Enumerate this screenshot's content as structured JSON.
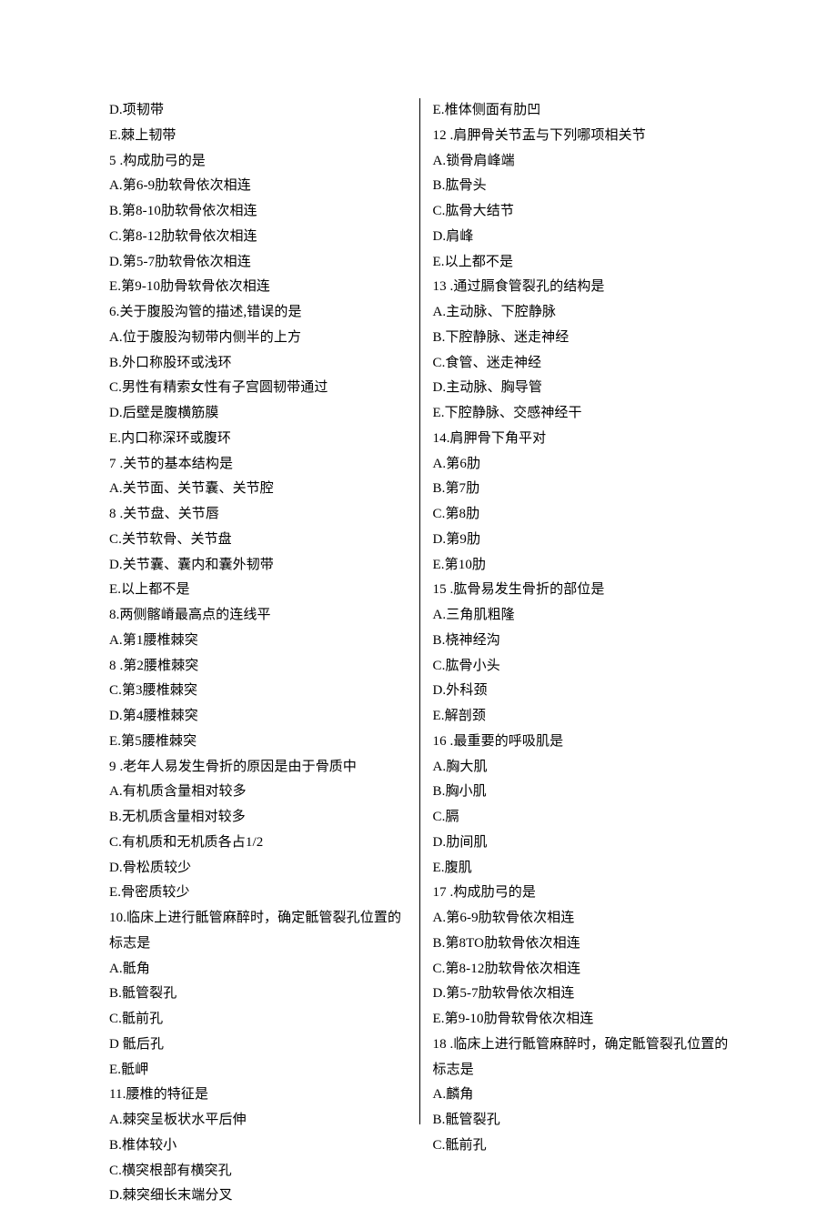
{
  "left": [
    "D.项韧带",
    "E.棘上韧带",
    "5 .构成肋弓的是",
    "A.第6-9肋软骨依次相连",
    "B.第8-10肋软骨依次相连",
    "C.第8-12肋软骨依次相连",
    "D.第5-7肋软骨依次相连",
    "E.第9-10肋骨软骨依次相连",
    "6.关于腹股沟管的描述,错误的是",
    "A.位于腹股沟韧带内侧半的上方",
    "B.外口称股环或浅环",
    "C.男性有精索女性有子宫圆韧带通过",
    "D.后壁是腹横筋膜",
    "E.内口称深环或腹环",
    "7 .关节的基本结构是",
    "A.关节面、关节囊、关节腔",
    "8 .关节盘、关节唇",
    "C.关节软骨、关节盘",
    "D.关节囊、囊内和囊外韧带",
    "E.以上都不是",
    "8.两侧髂嵴最高点的连线平",
    "A.第1腰椎棘突",
    "8 .第2腰椎棘突",
    "C.第3腰椎棘突",
    "D.第4腰椎棘突",
    "E.第5腰椎棘突",
    "9 .老年人易发生骨折的原因是由于骨质中",
    "A.有机质含量相对较多",
    "B.无机质含量相对较多",
    "C.有机质和无机质各占1/2",
    "D.骨松质较少",
    "E.骨密质较少",
    "10.临床上进行骶管麻醉时，确定骶管裂孔位置的标志是",
    "A.骶角",
    "B.骶管裂孔",
    "C.骶前孔",
    "D 骶后孔",
    "E.骶岬",
    "11.腰椎的特征是",
    "A.棘突呈板状水平后伸",
    "B.椎体较小",
    "C.横突根部有横突孔",
    "D.棘突细长末端分叉"
  ],
  "right": [
    "E.椎体侧面有肋凹",
    "12 .肩胛骨关节盂与下列哪项相关节",
    "A.锁骨肩峰端",
    "B.肱骨头",
    "C.肱骨大结节",
    "D.肩峰",
    "E.以上都不是",
    "13 .通过膈食管裂孔的结构是",
    "A.主动脉、下腔静脉",
    "B.下腔静脉、迷走神经",
    "C.食管、迷走神经",
    "D.主动脉、胸导管",
    "E.下腔静脉、交感神经干",
    "14.肩胛骨下角平对",
    "A.第6肋",
    "B.第7肋",
    "C.第8肋",
    "D.第9肋",
    "E.第10肋",
    "15 .肱骨易发生骨折的部位是",
    "A.三角肌粗隆",
    "B.桡神经沟",
    "C.肱骨小头",
    "D.外科颈",
    "E.解剖颈",
    "16 .最重要的呼吸肌是",
    "A.胸大肌",
    "B.胸小肌",
    "C.膈",
    "D.肋间肌",
    "E.腹肌",
    "17 .构成肋弓的是",
    "A.第6-9肋软骨依次相连",
    "B.第8TO肋软骨依次相连",
    "C.第8-12肋软骨依次相连",
    "D.第5-7肋软骨依次相连",
    "E.第9-10肋骨软骨依次相连",
    "18 .临床上进行骶管麻醉时，确定骶管裂孔位置的标志是",
    "A.麟角",
    "B.骶管裂孔",
    "C.骶前孔"
  ]
}
